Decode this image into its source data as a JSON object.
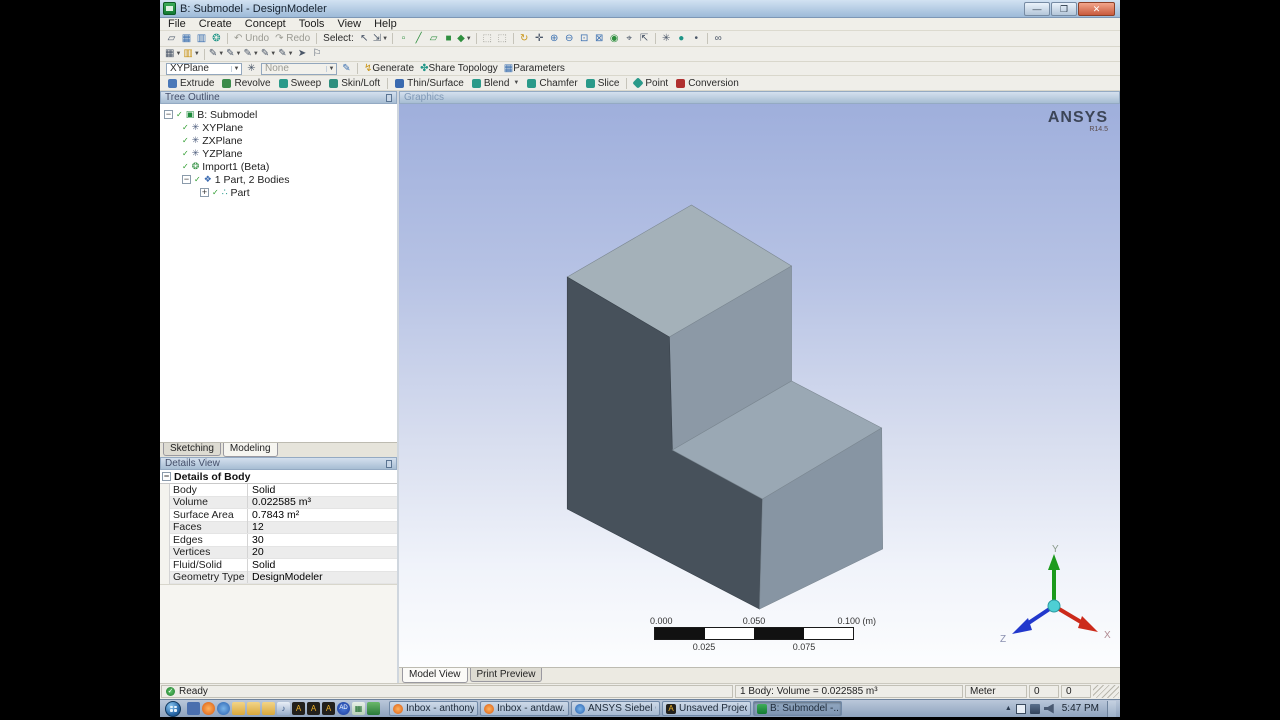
{
  "window": {
    "title": "B: Submodel - DesignModeler"
  },
  "menu": {
    "items": [
      "File",
      "Create",
      "Concept",
      "Tools",
      "View",
      "Help"
    ]
  },
  "toolbars": {
    "select_label": "Select:",
    "undo_label": "Undo",
    "redo_label": "Redo",
    "plane_selected": "XYPlane",
    "sketch_selected": "None",
    "generate_label": "Generate",
    "share_topology_label": "Share Topology",
    "parameters_label": "Parameters",
    "features": {
      "extrude": "Extrude",
      "revolve": "Revolve",
      "sweep": "Sweep",
      "skin_loft": "Skin/Loft",
      "thin_surface": "Thin/Surface",
      "blend": "Blend",
      "chamfer": "Chamfer",
      "slice": "Slice",
      "point": "Point",
      "conversion": "Conversion"
    }
  },
  "tree": {
    "header": "Tree Outline",
    "root_label": "B: Submodel",
    "items": [
      {
        "label": "XYPlane"
      },
      {
        "label": "ZXPlane"
      },
      {
        "label": "YZPlane"
      },
      {
        "label": "Import1 (Beta)"
      },
      {
        "label": "1 Part, 2 Bodies"
      },
      {
        "label": "Part"
      }
    ]
  },
  "mode_tabs": {
    "sketching": "Sketching",
    "modeling": "Modeling"
  },
  "details": {
    "header": "Details View",
    "group_title": "Details of Body",
    "rows": [
      {
        "label": "Body",
        "value": "Solid"
      },
      {
        "label": "Volume",
        "value": "0.022585 m³"
      },
      {
        "label": "Surface Area",
        "value": "0.7843 m²"
      },
      {
        "label": "Faces",
        "value": "12"
      },
      {
        "label": "Edges",
        "value": "30"
      },
      {
        "label": "Vertices",
        "value": "20"
      },
      {
        "label": "Fluid/Solid",
        "value": "Solid"
      },
      {
        "label": "Geometry Type",
        "value": "DesignModeler"
      }
    ]
  },
  "graphics": {
    "header": "Graphics",
    "logo_text": "ANSYS",
    "logo_version": "R14.5",
    "model_colors": {
      "top": "#a4b1b9",
      "column_right": "#8c99a6",
      "front_dark": "#47515b",
      "step_top": "#9aa8b4",
      "step_right": "#8795a3"
    },
    "ruler": {
      "label_0": "0.000",
      "label_mid": "0.050",
      "label_end": "0.100 (m)",
      "label_q1": "0.025",
      "label_q3": "0.075"
    },
    "triad": {
      "x_label": "X",
      "y_label": "Y",
      "z_label": "Z"
    }
  },
  "view_tabs": {
    "model_view": "Model View",
    "print_preview": "Print Preview"
  },
  "statusbar": {
    "status": "Ready",
    "selection_info": "1 Body: Volume = 0.022585 m³",
    "unit": "Meter",
    "coord_a": "0",
    "coord_b": "0"
  },
  "taskbar": {
    "task_buttons": [
      {
        "label": "Inbox - anthony..."
      },
      {
        "label": "Inbox - antdaw..."
      },
      {
        "label": "ANSYS Siebel C..."
      },
      {
        "label": "Unsaved Project..."
      },
      {
        "label": "B: Submodel -..."
      }
    ],
    "clock": "5:47 PM"
  }
}
